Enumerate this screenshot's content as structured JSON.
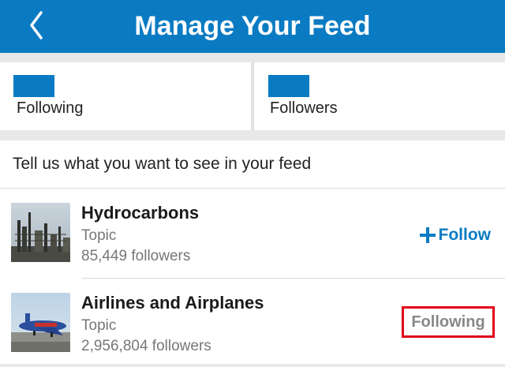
{
  "header": {
    "title": "Manage Your Feed",
    "back_icon": "chevron-left-icon",
    "background": "#0a7bc3"
  },
  "stats": [
    {
      "label": "Following"
    },
    {
      "label": "Followers"
    }
  ],
  "feed": {
    "prompt": "Tell us what you want to see in your feed",
    "topics": [
      {
        "name": "Hydrocarbons",
        "type": "Topic",
        "followers": "85,449 followers",
        "action_label": "Follow",
        "action_icon": "plus-icon",
        "following": false,
        "thumbnail": "refinery-image"
      },
      {
        "name": "Airlines and Airplanes",
        "type": "Topic",
        "followers": "2,956,804 followers",
        "action_label": "Following",
        "following": true,
        "highlighted": true,
        "thumbnail": "airplane-image"
      }
    ]
  },
  "colors": {
    "accent": "#0a7bc3",
    "highlight_border": "#e0001a",
    "muted_text": "#777777"
  }
}
